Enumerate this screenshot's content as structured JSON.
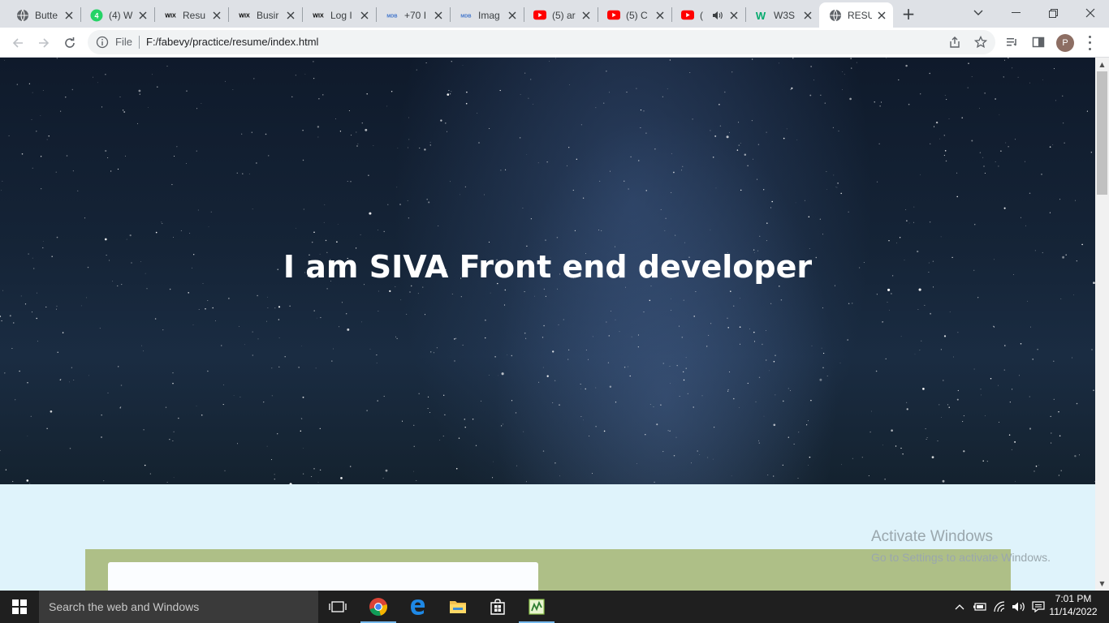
{
  "browser": {
    "tabs": [
      {
        "title": "Butte",
        "favicon": "globe-icon",
        "active": false
      },
      {
        "title": "(4) W",
        "favicon": "whatsapp-icon",
        "active": false
      },
      {
        "title": "Resu",
        "favicon": "wix-icon",
        "active": false
      },
      {
        "title": "Busir",
        "favicon": "wix-icon",
        "active": false
      },
      {
        "title": "Log I",
        "favicon": "wix-icon",
        "active": false
      },
      {
        "title": "+70 I",
        "favicon": "mdb-icon",
        "active": false
      },
      {
        "title": "Imag",
        "favicon": "mdb-icon",
        "active": false
      },
      {
        "title": "(5) ar",
        "favicon": "youtube-icon",
        "active": false
      },
      {
        "title": "(5) C",
        "favicon": "youtube-icon",
        "active": false
      },
      {
        "title": "(",
        "favicon": "youtube-icon",
        "active": false,
        "audio": true
      },
      {
        "title": "W3S",
        "favicon": "w3schools-icon",
        "active": false
      },
      {
        "title": "RESU",
        "favicon": "globe-icon",
        "active": true
      }
    ],
    "omnibox": {
      "scheme_label": "File",
      "url": "F:/fabevy/practice/resume/index.html"
    },
    "profile_initial": "P",
    "favicon_labels": {
      "wix": "WIX",
      "mdb": "MDB",
      "whatsapp": "4",
      "w3": "W"
    }
  },
  "page": {
    "hero_heading": "I am SIVA Front end developer"
  },
  "watermark": {
    "line1": "Activate Windows",
    "line2": "Go to Settings to activate Windows."
  },
  "taskbar": {
    "search_placeholder": "Search the web and Windows",
    "time": "7:01 PM",
    "date": "11/14/2022"
  },
  "colors": {
    "tabstrip": "#dee1e6",
    "page_bg": "#dff3fb",
    "about_bg": "#aebf87",
    "taskbar": "#1f1f1f"
  }
}
